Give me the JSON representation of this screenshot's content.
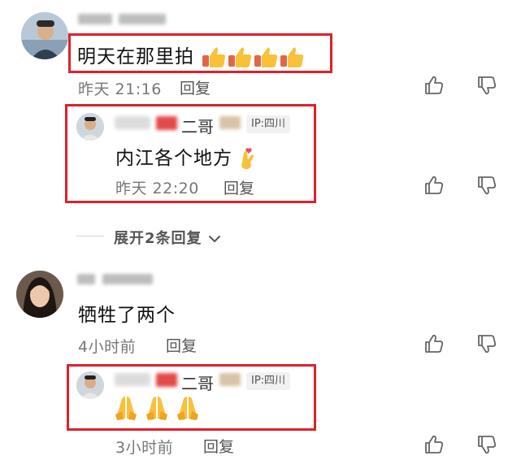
{
  "comments": [
    {
      "text": "明天在那里拍",
      "time": "昨天 21:16",
      "reply_label": "回复",
      "emoji": "thumbs-up",
      "emoji_count": 4,
      "reply": {
        "name_suffix": "二哥",
        "ip": "IP:四川",
        "text": "内江各个地方",
        "emoji": "hand-with-index-and-thumb-crossed",
        "time": "昨天 22:20",
        "reply_label": "回复"
      }
    },
    {
      "text": "牺牲了两个",
      "time": "4小时前",
      "reply_label": "回复",
      "reply": {
        "name_suffix": "二哥",
        "ip": "IP:四川",
        "emoji": "folded-hands",
        "emoji_count": 3,
        "time": "3小时前",
        "reply_label": "回复"
      }
    }
  ],
  "expand": {
    "label": "展开2条回复"
  },
  "icons": {
    "like": "thumb-up-outline",
    "dislike": "thumb-down-outline",
    "chevron": "chevron-down"
  },
  "colors": {
    "highlight": "#e0202a",
    "meta": "#777777"
  }
}
